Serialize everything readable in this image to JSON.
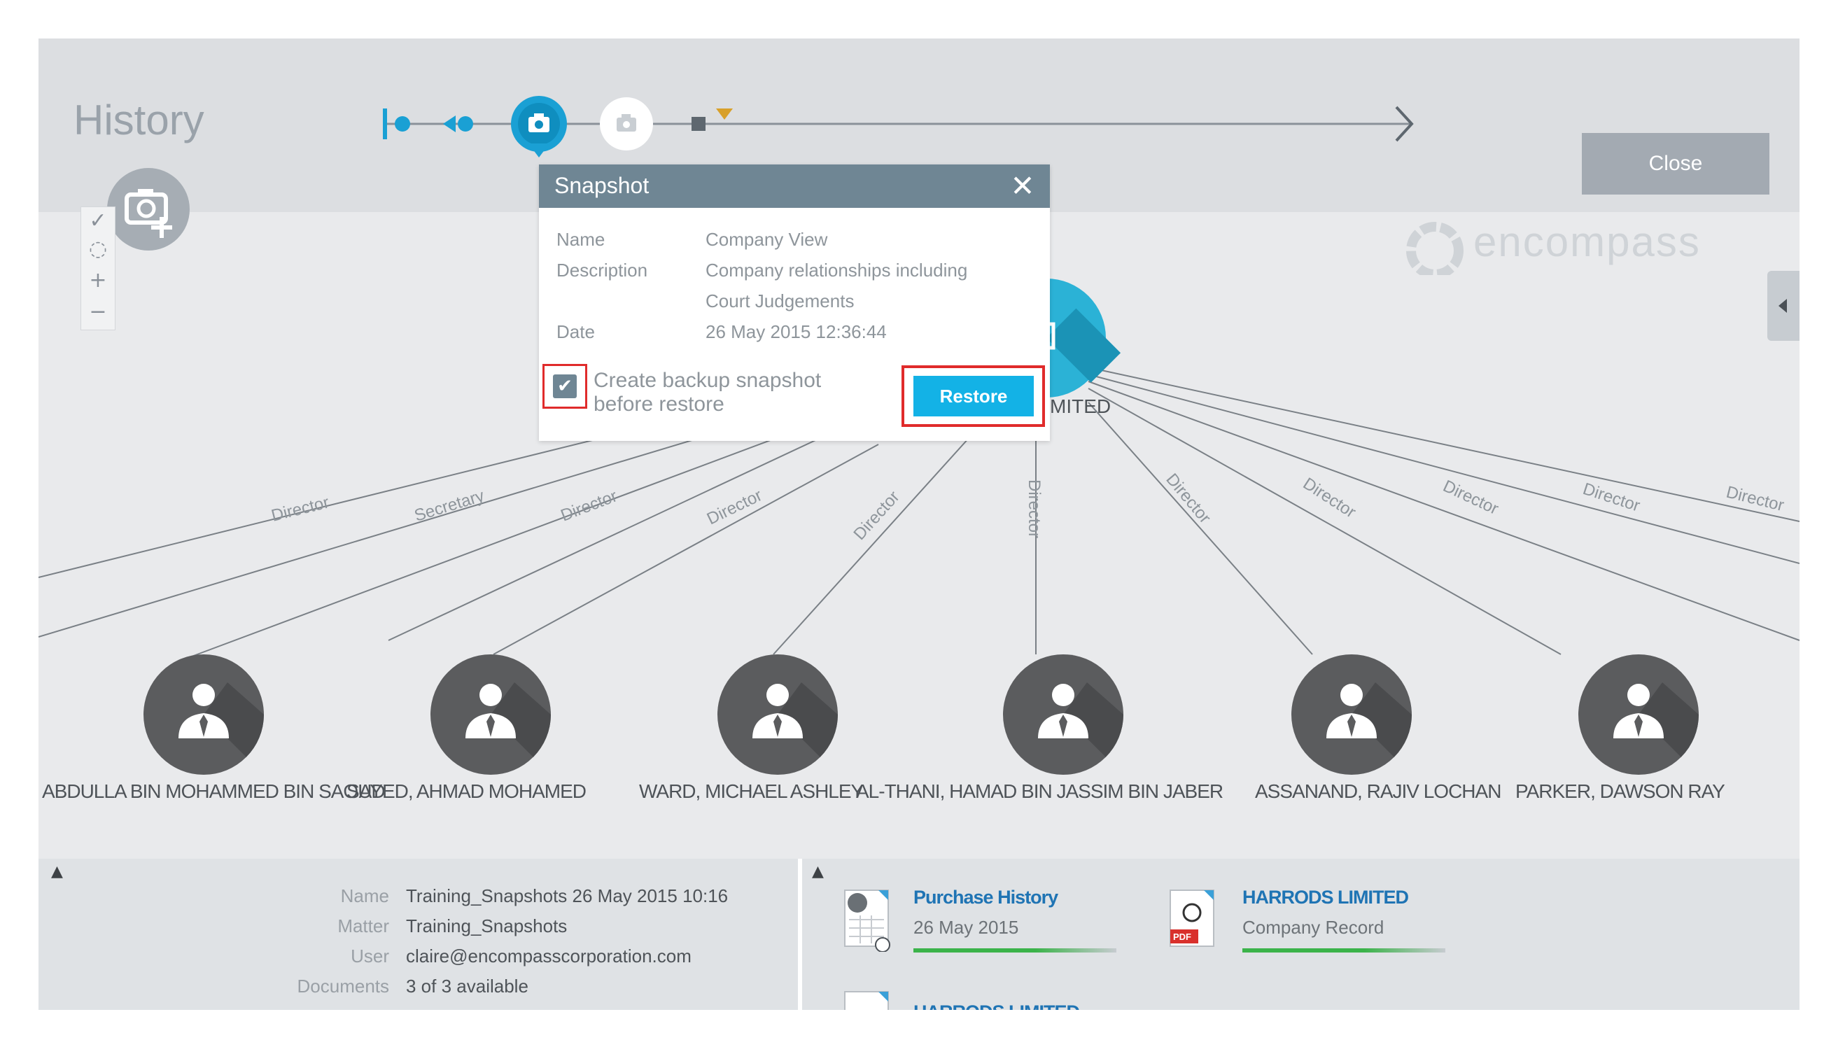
{
  "header": {
    "title": "History",
    "close_label": "Close"
  },
  "brand": {
    "name": "encompass"
  },
  "snapshot_dialog": {
    "title": "Snapshot",
    "fields": [
      {
        "label": "Name",
        "value": "Company View"
      },
      {
        "label": "Description",
        "value": "Company relationships including"
      },
      {
        "label": "",
        "value": "Court Judgements"
      },
      {
        "label": "Date",
        "value": "26 May 2015 12:36:44"
      }
    ],
    "backup_checkbox": {
      "checked": true,
      "label_line1": "Create backup snapshot",
      "label_line2": "before restore"
    },
    "restore_label": "Restore"
  },
  "graph": {
    "company_label_suffix": "MITED",
    "edge_labels": [
      "Director",
      "Secretary",
      "Director",
      "Director",
      "Director",
      "Director",
      "Director",
      "Director",
      "Director",
      "Director",
      "Director"
    ],
    "people": [
      "ABDULLA BIN MOHAMMED BIN SAOUD",
      "SAYED, AHMAD MOHAMED",
      "WARD, MICHAEL ASHLEY",
      "AL-THANI, HAMAD BIN JASSIM BIN JABER",
      "ASSANAND, RAJIV LOCHAN",
      "PARKER, DAWSON RAY"
    ]
  },
  "bottom_panel": {
    "info": [
      {
        "label": "Name",
        "value": "Training_Snapshots 26 May 2015 10:16"
      },
      {
        "label": "Matter",
        "value": "Training_Snapshots"
      },
      {
        "label": "User",
        "value": "claire@encompasscorporation.com"
      },
      {
        "label": "Documents",
        "value": "3 of 3 available"
      }
    ],
    "documents": [
      {
        "title": "Purchase History",
        "subtitle": "26 May 2015",
        "icon": "spreadsheet-clock-icon"
      },
      {
        "title": "HARRODS LIMITED",
        "subtitle": "Company Record",
        "icon": "pdf-document-icon"
      },
      {
        "title": "HARRODS LIMITED",
        "subtitle": "",
        "icon": "document-icon"
      }
    ]
  },
  "colors": {
    "accent": "#13b2e6",
    "highlight_outline": "#e02b2b",
    "dialog_header": "#6f8694",
    "person_node": "#5b5c5e",
    "link": "#1f74b4"
  }
}
